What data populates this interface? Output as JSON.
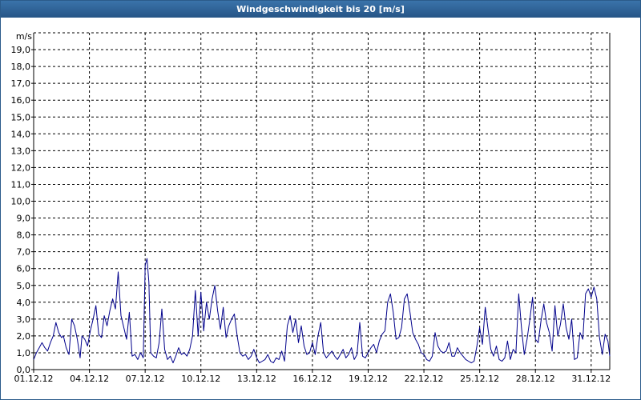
{
  "window": {
    "title": "Windgeschwindigkeit bis 20 [m/s]"
  },
  "colors": {
    "title_bar": "#2f6193",
    "title_text": "#ffffff",
    "series_line": "#00008b",
    "grid": "#000000",
    "axis": "#000000"
  },
  "chart_data": {
    "type": "line",
    "title": "Windgeschwindigkeit bis 20 [m/s]",
    "ylabel": "m/s",
    "xlabel": "",
    "ylim": [
      0,
      20
    ],
    "xlim": [
      "01.12.12",
      "01.01.13"
    ],
    "grid": true,
    "legend": "none",
    "y_ticks": [
      "0,0",
      "1,0",
      "2,0",
      "3,0",
      "4,0",
      "5,0",
      "6,0",
      "7,0",
      "8,0",
      "9,0",
      "10,0",
      "11,0",
      "12,0",
      "13,0",
      "14,0",
      "15,0",
      "16,0",
      "17,0",
      "18,0",
      "19,0"
    ],
    "x_ticks": [
      "01.12.12",
      "04.12.12",
      "07.12.12",
      "10.12.12",
      "13.12.12",
      "16.12.12",
      "19.12.12",
      "22.12.12",
      "25.12.12",
      "28.12.12",
      "31.12.12"
    ],
    "x_unit": "days",
    "series": [
      {
        "color": "#00008b",
        "x": [
          0.0,
          0.15,
          0.3,
          0.45,
          0.6,
          0.75,
          0.9,
          1.05,
          1.2,
          1.35,
          1.5,
          1.6,
          1.75,
          1.9,
          2.05,
          2.2,
          2.35,
          2.5,
          2.6,
          2.75,
          2.9,
          3.05,
          3.2,
          3.35,
          3.5,
          3.65,
          3.8,
          3.95,
          4.1,
          4.25,
          4.4,
          4.55,
          4.7,
          4.85,
          5.0,
          5.15,
          5.3,
          5.45,
          5.6,
          5.75,
          5.9,
          6.0,
          6.1,
          6.2,
          6.3,
          6.45,
          6.6,
          6.75,
          6.9,
          7.05,
          7.2,
          7.35,
          7.5,
          7.65,
          7.8,
          7.95,
          8.1,
          8.25,
          8.4,
          8.55,
          8.7,
          8.85,
          9.0,
          9.15,
          9.3,
          9.45,
          9.6,
          9.75,
          9.9,
          10.05,
          10.2,
          10.35,
          10.5,
          10.65,
          10.8,
          10.95,
          11.1,
          11.25,
          11.4,
          11.55,
          11.7,
          11.85,
          12.0,
          12.15,
          12.3,
          12.45,
          12.6,
          12.75,
          12.9,
          13.05,
          13.2,
          13.35,
          13.5,
          13.65,
          13.8,
          13.95,
          14.1,
          14.25,
          14.4,
          14.55,
          14.7,
          14.85,
          15.0,
          15.15,
          15.3,
          15.45,
          15.6,
          15.75,
          15.9,
          16.05,
          16.2,
          16.35,
          16.5,
          16.65,
          16.8,
          16.95,
          17.1,
          17.25,
          17.4,
          17.55,
          17.7,
          17.85,
          18.0,
          18.15,
          18.3,
          18.45,
          18.6,
          18.75,
          18.9,
          19.05,
          19.2,
          19.35,
          19.5,
          19.65,
          19.8,
          19.95,
          20.1,
          20.25,
          20.4,
          20.55,
          20.7,
          20.85,
          21.0,
          21.15,
          21.3,
          21.45,
          21.6,
          21.75,
          21.9,
          22.05,
          22.2,
          22.35,
          22.5,
          22.65,
          22.8,
          22.95,
          23.1,
          23.25,
          23.4,
          23.55,
          23.7,
          23.85,
          24.0,
          24.15,
          24.3,
          24.45,
          24.6,
          24.75,
          24.9,
          25.05,
          25.2,
          25.35,
          25.5,
          25.65,
          25.8,
          25.95,
          26.1,
          26.25,
          26.4,
          26.55,
          26.7,
          26.85,
          27.0,
          27.15,
          27.3,
          27.45,
          27.6,
          27.75,
          27.9,
          28.05,
          28.2,
          28.35,
          28.5,
          28.65,
          28.8,
          28.95,
          29.1,
          29.25,
          29.4,
          29.55,
          29.7,
          29.85,
          30.0,
          30.15,
          30.3,
          30.45,
          30.6,
          30.75,
          30.9,
          31.0
        ],
        "y": [
          0.6,
          1.0,
          1.3,
          1.6,
          1.3,
          1.1,
          1.6,
          2.0,
          2.8,
          2.2,
          1.9,
          2.0,
          1.3,
          0.9,
          3.0,
          2.6,
          1.8,
          0.7,
          2.0,
          1.8,
          1.4,
          2.3,
          3.0,
          3.8,
          2.1,
          1.9,
          3.2,
          2.6,
          3.5,
          4.2,
          3.6,
          5.8,
          3.2,
          2.5,
          1.8,
          3.4,
          0.8,
          0.9,
          0.6,
          1.0,
          0.7,
          6.2,
          6.6,
          5.2,
          1.0,
          0.8,
          0.7,
          1.6,
          3.6,
          1.2,
          0.6,
          0.8,
          0.4,
          0.8,
          1.3,
          0.9,
          1.0,
          0.8,
          1.2,
          2.0,
          4.7,
          2.0,
          4.6,
          2.3,
          4.0,
          3.0,
          4.2,
          5.0,
          3.5,
          2.4,
          3.7,
          1.9,
          2.6,
          3.0,
          3.3,
          2.0,
          1.0,
          0.8,
          0.9,
          0.6,
          0.8,
          1.2,
          0.7,
          0.4,
          0.5,
          0.6,
          0.9,
          0.5,
          0.4,
          0.7,
          0.6,
          1.1,
          0.5,
          2.6,
          3.2,
          2.2,
          3.0,
          1.6,
          2.6,
          1.4,
          0.9,
          1.0,
          1.6,
          0.9,
          2.0,
          2.8,
          1.0,
          0.7,
          0.9,
          1.1,
          0.8,
          0.6,
          0.9,
          1.2,
          0.7,
          0.9,
          1.3,
          0.6,
          0.9,
          2.8,
          0.8,
          0.7,
          1.0,
          1.3,
          1.5,
          1.0,
          1.7,
          2.1,
          2.3,
          4.0,
          4.5,
          3.4,
          1.8,
          1.9,
          2.5,
          4.2,
          4.5,
          3.4,
          2.2,
          1.8,
          1.5,
          1.0,
          0.9,
          0.6,
          0.5,
          0.8,
          2.2,
          1.4,
          1.1,
          1.0,
          1.1,
          1.6,
          0.8,
          0.8,
          1.3,
          1.0,
          0.8,
          0.6,
          0.5,
          0.4,
          0.5,
          1.4,
          2.5,
          1.5,
          3.7,
          2.4,
          1.2,
          0.8,
          1.4,
          0.6,
          0.5,
          0.7,
          1.7,
          0.6,
          1.2,
          1.0,
          4.5,
          2.5,
          0.9,
          1.8,
          3.0,
          4.3,
          1.8,
          1.6,
          2.9,
          3.9,
          2.8,
          2.2,
          1.1,
          3.8,
          2.0,
          2.7,
          3.9,
          2.5,
          1.8,
          3.0,
          0.6,
          0.7,
          2.2,
          1.8,
          4.5,
          4.8,
          4.3,
          4.9,
          4.2,
          1.9,
          0.9,
          2.1,
          1.7,
          0.8
        ],
        "y_tail_note": ""
      }
    ]
  }
}
